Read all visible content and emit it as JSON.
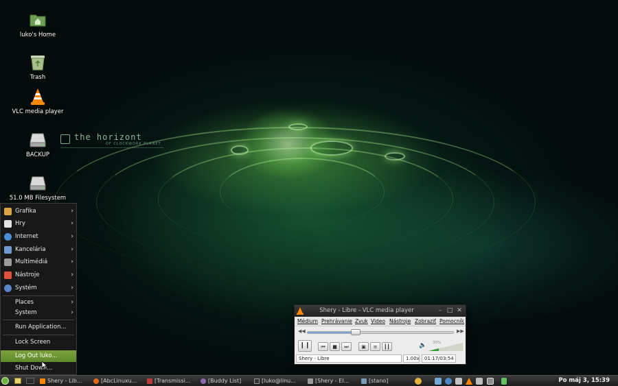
{
  "wallpaper": {
    "title": "the horizont",
    "subtitle": "OF CLOCKWORK PLANET"
  },
  "desktop_icons": [
    {
      "label": "luko's Home",
      "icon": "home-folder-icon"
    },
    {
      "label": "Trash",
      "icon": "trash-icon"
    },
    {
      "label": "VLC media player",
      "icon": "vlc-cone-icon"
    },
    {
      "label": "BACKUP",
      "icon": "drive-icon"
    },
    {
      "label": "51.0 MB Filesystem",
      "icon": "drive-icon"
    }
  ],
  "menu": {
    "categories": [
      {
        "label": "Grafika",
        "icon": "brush-icon",
        "color": "#d9a441"
      },
      {
        "label": "Hry",
        "icon": "cards-icon",
        "color": "#e3e3e3"
      },
      {
        "label": "Internet",
        "icon": "globe-icon",
        "color": "#4c8ed6"
      },
      {
        "label": "Kancelária",
        "icon": "office-icon",
        "color": "#6f9ad0"
      },
      {
        "label": "Multimédiá",
        "icon": "multimedia-icon",
        "color": "#9c9c9c"
      },
      {
        "label": "Nástroje",
        "icon": "tools-icon",
        "color": "#e0503a"
      },
      {
        "label": "Systém",
        "icon": "gear-icon",
        "color": "#5a86c9"
      }
    ],
    "places_label": "Places",
    "system_label": "System",
    "run_label": "Run Application...",
    "lock_label": "Lock Screen",
    "logout_label": "Log Out luko...",
    "shutdown_label": "Shut Down..."
  },
  "vlc": {
    "title": "Shery - Libre - VLC media player",
    "menu": [
      "Médium",
      "Prehrávanie",
      "Zvuk",
      "Video",
      "Nástroje",
      "Zobraziť",
      "Pomocník"
    ],
    "seek_fraction": 0.33,
    "volume_percent": "30%",
    "volume_fraction": 0.3,
    "now_playing": "Shery - Libre",
    "speed": "1.00x",
    "time": "01:17/03:54",
    "accent": "#ff8800"
  },
  "taskbar": {
    "buttons": [
      {
        "label": "Shery - Lib...",
        "icon": "vlc-cone-icon",
        "color": "#ff8800"
      },
      {
        "label": "[AbcLinuxu...",
        "icon": "firefox-icon",
        "color": "#e06a1a"
      },
      {
        "label": "[Transmissi...",
        "icon": "transmission-icon",
        "color": "#bb3b3b"
      },
      {
        "label": "[Buddy List]",
        "icon": "pidgin-icon",
        "color": "#8a6bb0"
      },
      {
        "label": "[luko@linu...",
        "icon": "terminal-icon",
        "color": "#333333"
      },
      {
        "label": "[Shery - El...",
        "icon": "folder-icon",
        "color": "#9a9a9a"
      },
      {
        "label": "[stano]",
        "icon": "chat-icon",
        "color": "#7a9ab8"
      }
    ],
    "clock": "Po máj  3, 15:39"
  }
}
